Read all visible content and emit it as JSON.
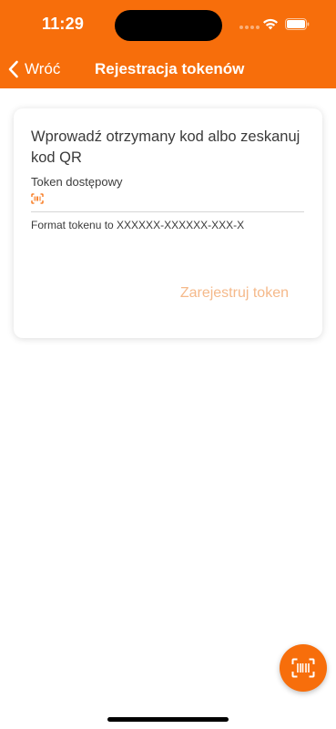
{
  "status_bar": {
    "time": "11:29"
  },
  "nav": {
    "back_label": "Wróć",
    "title": "Rejestracja tokenów"
  },
  "card": {
    "heading": "Wprowadź otrzymany kod albo zeskanuj kod QR",
    "field_label": "Token dostępowy",
    "field_value": "",
    "hint": "Format tokenu to XXXXXX-XXXXXX-XXX-X",
    "register_label": "Zarejestruj token"
  },
  "icons": {
    "back": "chevron-left-icon",
    "barcode": "barcode-scan-icon",
    "wifi": "wifi-icon",
    "battery": "battery-icon"
  },
  "colors": {
    "accent": "#F76E0B",
    "register_disabled": "#F5B98A",
    "text": "#3b3b3b"
  }
}
